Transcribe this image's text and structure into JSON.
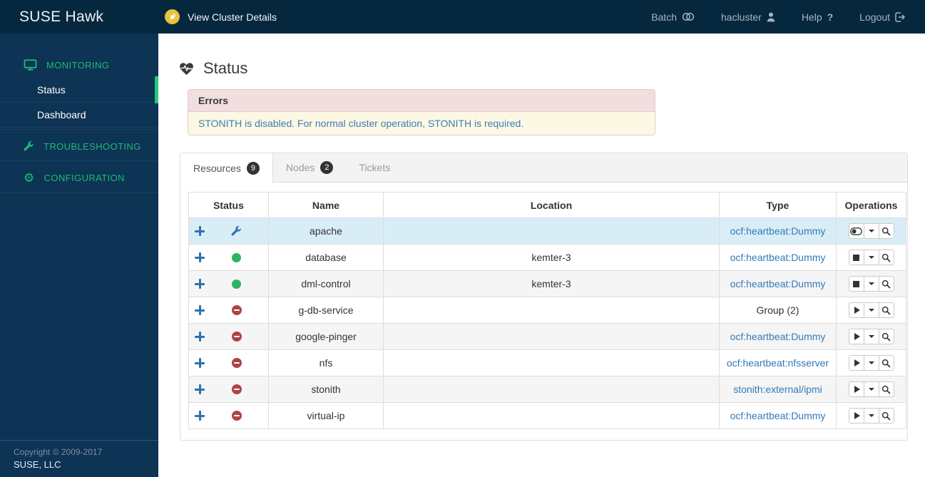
{
  "colors": {
    "header_bg": "#06283f",
    "sidebar_bg": "#0d3355",
    "accent_green": "#1abc73",
    "running_green": "#2eb263",
    "stopped_red": "#ae4441",
    "maintenance_blue": "#2d73ad",
    "link_blue": "#337ab7",
    "highlight_row_blue": "#d9edf7",
    "error_header_bg": "#f2dede",
    "error_body_bg": "#fcf8e3",
    "plug_badge_yellow": "#e7c33f"
  },
  "header": {
    "logo": "SUSE Hawk",
    "cluster_link": "View Cluster Details",
    "nav": [
      {
        "label": "Batch",
        "icon": "batch-toggle"
      },
      {
        "label": "hacluster",
        "icon": "user"
      },
      {
        "label": "Help",
        "icon": "question"
      },
      {
        "label": "Logout",
        "icon": "logout"
      }
    ]
  },
  "sidebar": {
    "sections": [
      {
        "label": "MONITORING",
        "icon": "monitor",
        "expanded": true,
        "items": [
          {
            "label": "Status",
            "active": true
          },
          {
            "label": "Dashboard",
            "active": false
          }
        ]
      },
      {
        "label": "TROUBLESHOOTING",
        "icon": "wrench",
        "expanded": false,
        "items": []
      },
      {
        "label": "CONFIGURATION",
        "icon": "gear",
        "expanded": false,
        "items": []
      }
    ],
    "footer": {
      "copyright": "Copyright © 2009-2017",
      "company": "SUSE, LLC"
    }
  },
  "main": {
    "title": "Status",
    "errors_panel": {
      "title": "Errors",
      "message": "STONITH is disabled. For normal cluster operation, STONITH is required."
    },
    "tabs": [
      {
        "label": "Resources",
        "badge": "9",
        "active": true
      },
      {
        "label": "Nodes",
        "badge": "2",
        "active": false
      },
      {
        "label": "Tickets",
        "badge": "",
        "active": false
      }
    ],
    "table": {
      "columns": [
        "Status",
        "Name",
        "Location",
        "Type",
        "Operations"
      ],
      "rows": [
        {
          "name": "apache",
          "status": "maintenance",
          "location": "",
          "type": "ocf:heartbeat:Dummy",
          "type_is_link": true,
          "primary_action": "toggle",
          "highlighted": true
        },
        {
          "name": "database",
          "status": "running",
          "location": "kemter-3",
          "type": "ocf:heartbeat:Dummy",
          "type_is_link": true,
          "primary_action": "stop",
          "highlighted": false
        },
        {
          "name": "dml-control",
          "status": "running",
          "location": "kemter-3",
          "type": "ocf:heartbeat:Dummy",
          "type_is_link": true,
          "primary_action": "stop",
          "highlighted": false
        },
        {
          "name": "g-db-service",
          "status": "stopped",
          "location": "",
          "type": "Group (2)",
          "type_is_link": false,
          "primary_action": "start",
          "highlighted": false
        },
        {
          "name": "google-pinger",
          "status": "stopped",
          "location": "",
          "type": "ocf:heartbeat:Dummy",
          "type_is_link": true,
          "primary_action": "start",
          "highlighted": false
        },
        {
          "name": "nfs",
          "status": "stopped",
          "location": "",
          "type": "ocf:heartbeat:nfsserver",
          "type_is_link": true,
          "primary_action": "start",
          "highlighted": false
        },
        {
          "name": "stonith",
          "status": "stopped",
          "location": "",
          "type": "stonith:external/ipmi",
          "type_is_link": true,
          "primary_action": "start",
          "highlighted": false
        },
        {
          "name": "virtual-ip",
          "status": "stopped",
          "location": "",
          "type": "ocf:heartbeat:Dummy",
          "type_is_link": true,
          "primary_action": "start",
          "highlighted": false
        }
      ]
    }
  }
}
